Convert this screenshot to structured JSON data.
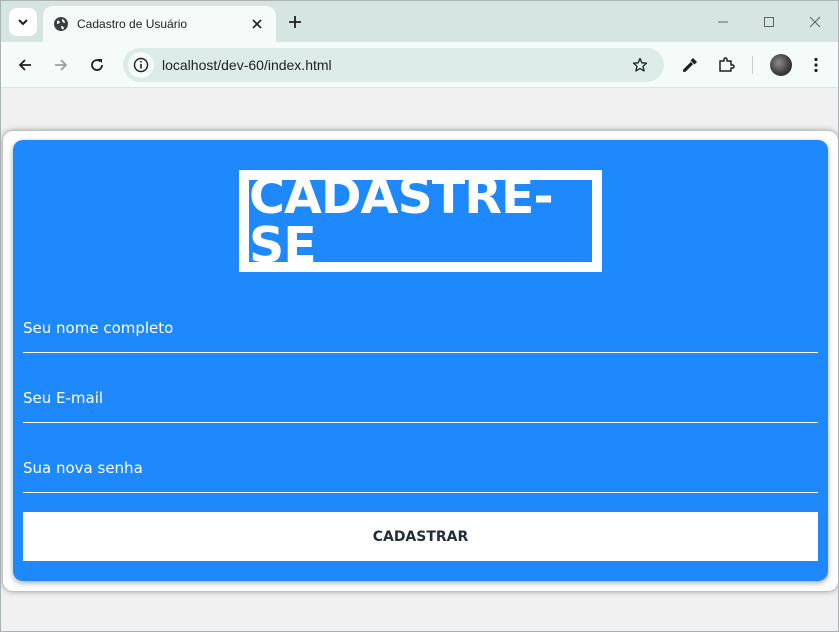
{
  "browser": {
    "tab_title": "Cadastro de Usuário",
    "url": "localhost/dev-60/index.html"
  },
  "form": {
    "heading": "CADASTRE-SE",
    "name_placeholder": "Seu nome completo",
    "email_placeholder": "Seu E-mail",
    "password_placeholder": "Sua nova senha",
    "submit_label": "CADASTRAR"
  },
  "colors": {
    "card_background": "#1e88fd",
    "text_on_card": "#ffffff",
    "button_background": "#ffffff"
  }
}
